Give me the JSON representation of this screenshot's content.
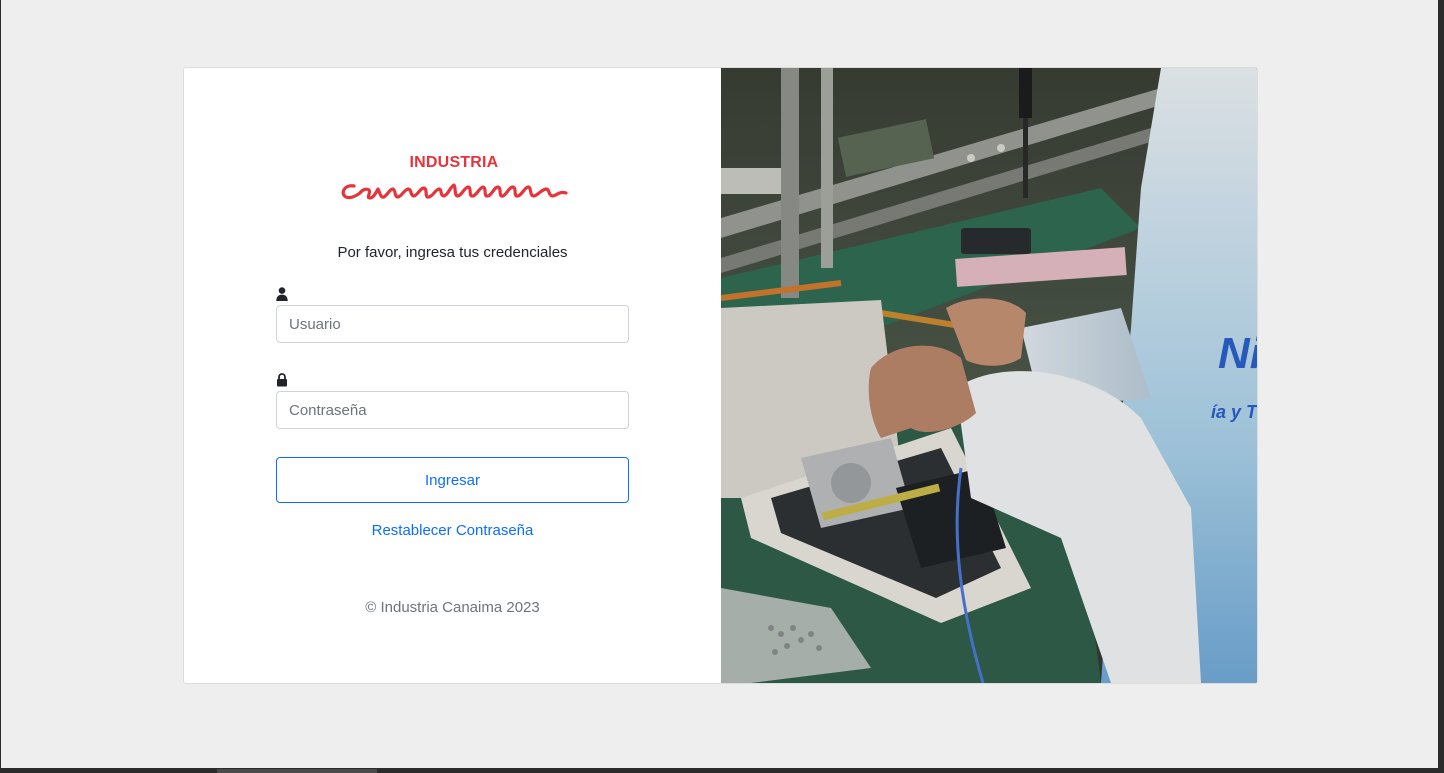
{
  "brand": {
    "logo_top": "INDUSTRIA",
    "logo_script": "canaima",
    "logo_color": "#e8333a"
  },
  "login": {
    "subtitle": "Por favor, ingresa tus credenciales",
    "username": {
      "icon": "user-icon",
      "placeholder": "Usuario",
      "value": ""
    },
    "password": {
      "icon": "lock-icon",
      "placeholder": "Contraseña",
      "value": ""
    },
    "submit_label": "Ingresar",
    "reset_link": "Restablecer Contraseña",
    "accent_color": "#0d6efd"
  },
  "footer": {
    "copyright": "© Industria Canaima 2023"
  },
  "hero": {
    "description_icon": "photo"
  }
}
